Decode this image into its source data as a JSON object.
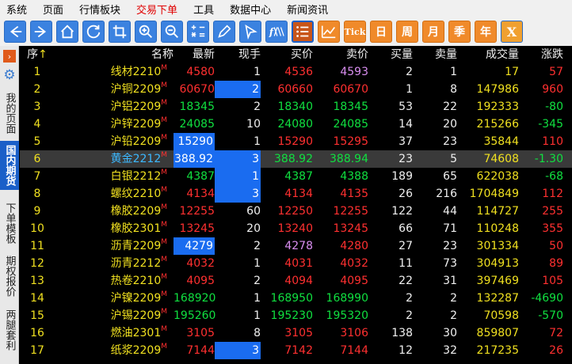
{
  "menu": [
    "系统",
    "页面",
    "行情板块",
    "交易下单",
    "工具",
    "数据中心",
    "新闻资讯"
  ],
  "menu_active_index": 3,
  "toolbar": {
    "icons": [
      "arrow-left-icon",
      "arrow-right-icon",
      "home-icon",
      "refresh-icon",
      "crop-icon",
      "zoom-in-icon",
      "zoom-out-icon",
      "formula-icon",
      "pencil-icon",
      "cursor-icon",
      "fx-icon",
      "list-icon",
      "trend-chart-icon"
    ],
    "tick": "Tick",
    "periods": [
      "日",
      "周",
      "月",
      "季",
      "年"
    ],
    "close": "X"
  },
  "sidebar": {
    "items": [
      "我的页面",
      "国内期货",
      "下单模板",
      "期权报价",
      "两腿套利"
    ],
    "active_index": 1
  },
  "columns": [
    "序",
    "名称",
    "最新",
    "现手",
    "买价",
    "卖价",
    "买量",
    "卖量",
    "成交量",
    "涨跌"
  ],
  "sort_arrow": "↑",
  "flag": "M",
  "rows": [
    {
      "n": "1",
      "name": "线材2210",
      "last": "4580",
      "vol": "1",
      "bid": "4536",
      "ask": "4593",
      "bq": "2",
      "aq": "1",
      "total": "17",
      "chg": "57"
    },
    {
      "n": "2",
      "name": "沪铜2209",
      "last": "60670",
      "vol": "2",
      "bid": "60660",
      "ask": "60670",
      "bq": "1",
      "aq": "8",
      "total": "147986",
      "chg": "960"
    },
    {
      "n": "3",
      "name": "沪铝2209",
      "last": "18345",
      "vol": "2",
      "bid": "18340",
      "ask": "18345",
      "bq": "53",
      "aq": "22",
      "total": "192333",
      "chg": "-80"
    },
    {
      "n": "4",
      "name": "沪锌2209",
      "last": "24085",
      "vol": "10",
      "bid": "24080",
      "ask": "24085",
      "bq": "14",
      "aq": "20",
      "total": "215266",
      "chg": "-345"
    },
    {
      "n": "5",
      "name": "沪铅2209",
      "last": "15290",
      "vol": "1",
      "bid": "15290",
      "ask": "15295",
      "bq": "37",
      "aq": "23",
      "total": "35844",
      "chg": "110"
    },
    {
      "n": "6",
      "name": "黄金2212",
      "last": "388.92",
      "vol": "3",
      "bid": "388.92",
      "ask": "388.94",
      "bq": "23",
      "aq": "5",
      "total": "74608",
      "chg": "-1.30"
    },
    {
      "n": "7",
      "name": "白银2212",
      "last": "4387",
      "vol": "1",
      "bid": "4387",
      "ask": "4388",
      "bq": "189",
      "aq": "65",
      "total": "622038",
      "chg": "-68"
    },
    {
      "n": "8",
      "name": "螺纹2210",
      "last": "4134",
      "vol": "3",
      "bid": "4134",
      "ask": "4135",
      "bq": "26",
      "aq": "216",
      "total": "1704849",
      "chg": "112"
    },
    {
      "n": "9",
      "name": "橡胶2209",
      "last": "12255",
      "vol": "60",
      "bid": "12250",
      "ask": "12255",
      "bq": "122",
      "aq": "44",
      "total": "114727",
      "chg": "255"
    },
    {
      "n": "10",
      "name": "橡胶2301",
      "last": "13245",
      "vol": "20",
      "bid": "13240",
      "ask": "13245",
      "bq": "66",
      "aq": "71",
      "total": "110248",
      "chg": "355"
    },
    {
      "n": "11",
      "name": "沥青2209",
      "last": "4279",
      "vol": "2",
      "bid": "4278",
      "ask": "4280",
      "bq": "27",
      "aq": "23",
      "total": "301334",
      "chg": "50"
    },
    {
      "n": "12",
      "name": "沥青2212",
      "last": "4032",
      "vol": "1",
      "bid": "4031",
      "ask": "4032",
      "bq": "11",
      "aq": "73",
      "total": "304913",
      "chg": "89"
    },
    {
      "n": "13",
      "name": "热卷2210",
      "last": "4095",
      "vol": "2",
      "bid": "4094",
      "ask": "4095",
      "bq": "22",
      "aq": "31",
      "total": "397469",
      "chg": "105"
    },
    {
      "n": "14",
      "name": "沪镍2209",
      "last": "168920",
      "vol": "1",
      "bid": "168950",
      "ask": "168990",
      "bq": "2",
      "aq": "2",
      "total": "132287",
      "chg": "-4690"
    },
    {
      "n": "15",
      "name": "沪锡2209",
      "last": "195260",
      "vol": "1",
      "bid": "195230",
      "ask": "195320",
      "bq": "2",
      "aq": "2",
      "total": "70598",
      "chg": "-570"
    },
    {
      "n": "16",
      "name": "燃油2301",
      "last": "3105",
      "vol": "8",
      "bid": "3105",
      "ask": "3106",
      "bq": "138",
      "aq": "30",
      "total": "859807",
      "chg": "72"
    },
    {
      "n": "17",
      "name": "纸浆2209",
      "last": "7144",
      "vol": "3",
      "bid": "7142",
      "ask": "7144",
      "bq": "12",
      "aq": "32",
      "total": "217235",
      "chg": "26"
    }
  ],
  "selected_row_index": 5,
  "colors": {
    "up": "#ff3030",
    "down": "#10e040",
    "neutral": "#f0f0f0",
    "name": "#f0e020",
    "highlight": "#1a6cf0",
    "accent": "#c8551a"
  }
}
